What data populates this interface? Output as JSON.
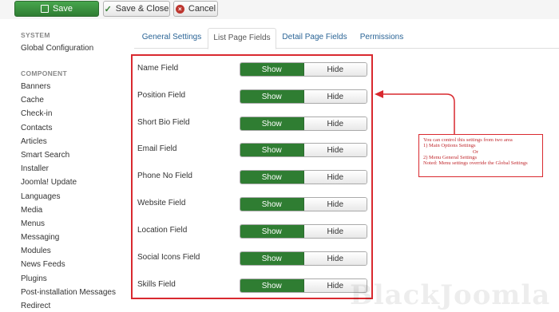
{
  "toolbar": {
    "save_label": "Save",
    "save_close_label": "Save & Close",
    "cancel_label": "Cancel"
  },
  "sidebar": {
    "system_heading": "SYSTEM",
    "global_configuration": "Global Configuration",
    "component_heading": "COMPONENT",
    "items": [
      "Banners",
      "Cache",
      "Check-in",
      "Contacts",
      "Articles",
      "Smart Search",
      "Installer",
      "Joomla! Update",
      "Languages",
      "Media",
      "Menus",
      "Messaging",
      "Modules",
      "News Feeds",
      "Plugins",
      "Post-installation Messages",
      "Redirect"
    ]
  },
  "tabs": [
    {
      "label": "General Settings",
      "active": false
    },
    {
      "label": "List Page Fields",
      "active": true
    },
    {
      "label": "Detail Page Fields",
      "active": false
    },
    {
      "label": "Permissions",
      "active": false
    }
  ],
  "fields": [
    {
      "label": "Name Field",
      "value": "Show"
    },
    {
      "label": "Position Field",
      "value": "Show"
    },
    {
      "label": "Short Bio Field",
      "value": "Show"
    },
    {
      "label": "Email Field",
      "value": "Show"
    },
    {
      "label": "Phone No Field",
      "value": "Show"
    },
    {
      "label": "Website Field",
      "value": "Show"
    },
    {
      "label": "Location Field",
      "value": "Show"
    },
    {
      "label": "Social Icons Field",
      "value": "Show"
    },
    {
      "label": "Skills Field",
      "value": "Show"
    }
  ],
  "toggle": {
    "show_label": "Show",
    "hide_label": "Hide"
  },
  "annotation": {
    "line1": "You can control this settings from two area",
    "line2": "1) Main Options Settings",
    "line3": "Or",
    "line4": "2) Menu General Settings",
    "line5": "Noted: Menu settings override the Global Settings"
  },
  "colors": {
    "accent_green": "#2f7d32",
    "annotation_red": "#d9292f",
    "link_blue": "#2a6496"
  },
  "watermark": "BlackJoomla"
}
